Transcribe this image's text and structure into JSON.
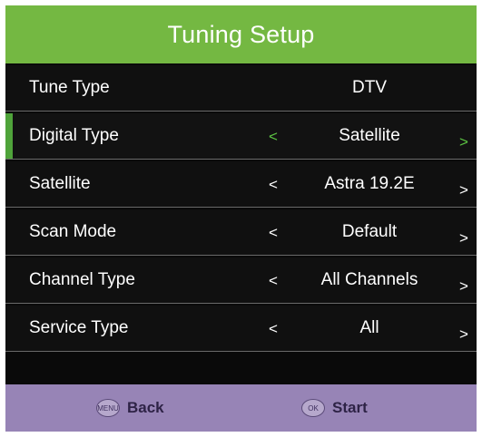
{
  "header": {
    "title": "Tuning Setup"
  },
  "rows": [
    {
      "label": "Tune Type",
      "value": "DTV",
      "has_arrows": false,
      "selected": false
    },
    {
      "label": "Digital Type",
      "value": "Satellite",
      "has_arrows": true,
      "selected": true
    },
    {
      "label": "Satellite",
      "value": "Astra 19.2E",
      "has_arrows": true,
      "selected": false
    },
    {
      "label": "Scan Mode",
      "value": "Default",
      "has_arrows": true,
      "selected": false
    },
    {
      "label": "Channel Type",
      "value": "All Channels",
      "has_arrows": true,
      "selected": false
    },
    {
      "label": "Service Type",
      "value": "All",
      "has_arrows": true,
      "selected": false
    }
  ],
  "arrows": {
    "left": "<",
    "right": ">"
  },
  "footer": {
    "back": {
      "icon_text": "MENU",
      "label": "Back"
    },
    "start": {
      "icon_text": "OK",
      "label": "Start"
    }
  },
  "colors": {
    "title_bar": "#74b842",
    "selection": "#4fa33a",
    "footer": "#9784b6"
  }
}
